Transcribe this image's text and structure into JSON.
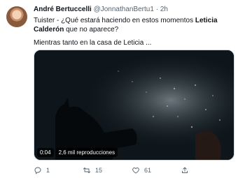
{
  "tweet": {
    "author_name": "André Bertuccelli",
    "handle": "@JonnathanBertu1",
    "separator": "·",
    "time": "2h",
    "text_before": "Tuister - ¿Qué estará haciendo en estos momentos ",
    "text_bold": "Leticia Calderón",
    "text_after": " que no aparece?",
    "paragraph2": "Mientras tanto en la casa de Leticia ..."
  },
  "video": {
    "duration": "0:04",
    "views": "2,6 mil reproducciones"
  },
  "actions": {
    "replies": "1",
    "retweets": "15",
    "likes": "61"
  }
}
